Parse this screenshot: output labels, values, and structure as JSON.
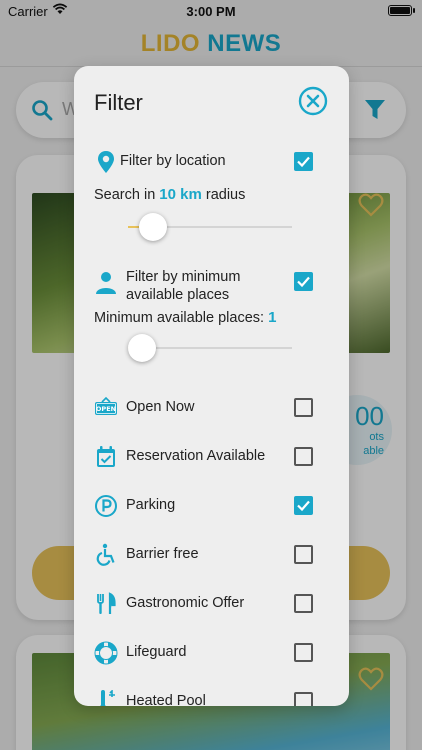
{
  "status_bar": {
    "carrier": "Carrier",
    "time": "3:00 PM"
  },
  "app": {
    "title_part1": "LIDO",
    "title_part2": "NEWS"
  },
  "search": {
    "placeholder": "W"
  },
  "card": {
    "spots_number": "00",
    "spots_line1": "ots",
    "spots_line2": "able"
  },
  "filter": {
    "title": "Filter",
    "location": {
      "label": "Filter by location",
      "checked": true
    },
    "radius": {
      "prefix": "Search in",
      "value": "10 km",
      "suffix": "radius",
      "slider_fraction": 0.15
    },
    "min_places": {
      "label": "Filter by minimum available places",
      "checked": true
    },
    "min_places_text": {
      "prefix": "Minimum available places:",
      "value": "1",
      "slider_fraction": 0.0
    },
    "options": [
      {
        "label": "Open Now",
        "icon": "open-sign-icon",
        "checked": false
      },
      {
        "label": "Reservation Available",
        "icon": "calendar-check-icon",
        "checked": false
      },
      {
        "label": "Parking",
        "icon": "parking-icon",
        "checked": true
      },
      {
        "label": "Barrier free",
        "icon": "wheelchair-icon",
        "checked": false
      },
      {
        "label": "Gastronomic Offer",
        "icon": "fork-knife-icon",
        "checked": false
      },
      {
        "label": "Lifeguard",
        "icon": "lifebuoy-icon",
        "checked": false
      },
      {
        "label": "Heated Pool",
        "icon": "thermometer-icon",
        "checked": false
      }
    ],
    "colors": {
      "accent": "#1aa7c9",
      "slider_fill": "#e8c25a"
    }
  }
}
